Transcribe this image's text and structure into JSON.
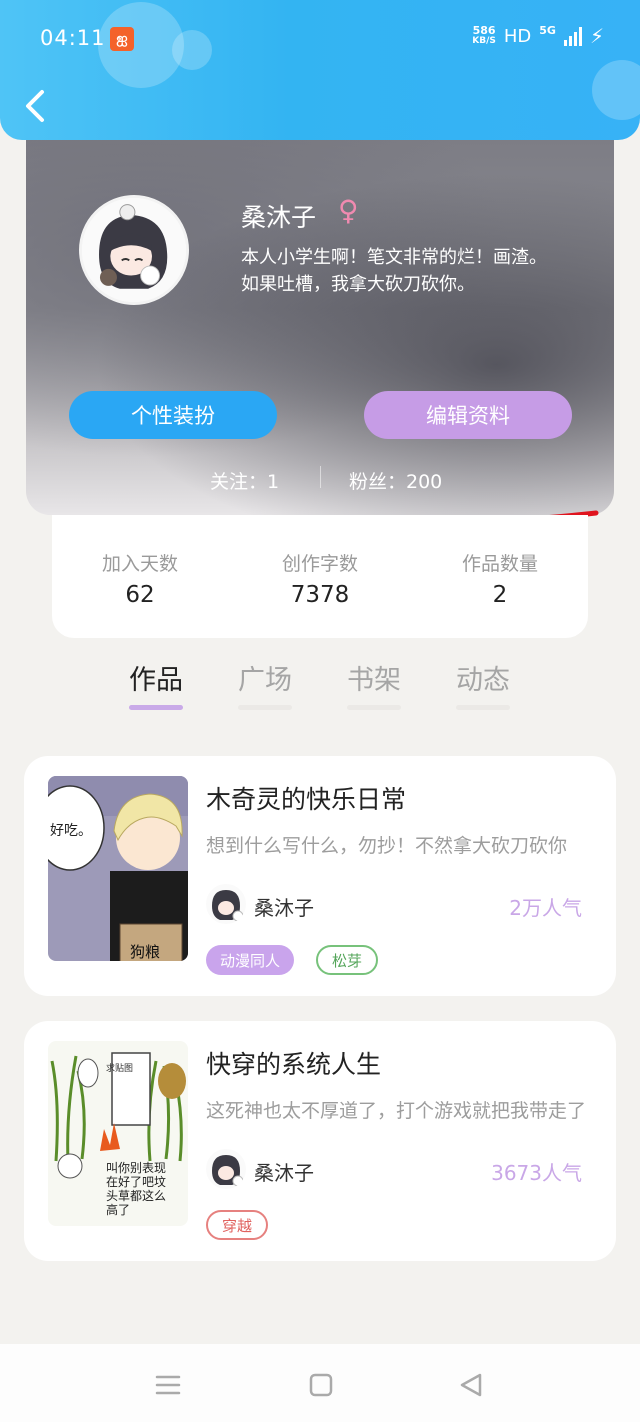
{
  "status_bar": {
    "time": "04:11",
    "app_badge": "ஐ",
    "net_speed_value": "586",
    "net_speed_unit": "KB/S",
    "hd": "HD",
    "network": "5G"
  },
  "profile": {
    "username": "桑沐子",
    "gender_symbol": "♀",
    "bio_line1": "本人小学生啊！笔文非常的烂！画渣。",
    "bio_line2": "如果吐槽，我拿大砍刀砍你。",
    "dress_up_label": "个性装扮",
    "edit_label": "编辑资料",
    "following_text": "关注：1",
    "fans_text": "粉丝：200"
  },
  "stats": [
    {
      "label": "加入天数",
      "value": "62"
    },
    {
      "label": "创作字数",
      "value": "7378"
    },
    {
      "label": "作品数量",
      "value": "2"
    }
  ],
  "tabs": [
    {
      "label": "作品",
      "active": true
    },
    {
      "label": "广场",
      "active": false
    },
    {
      "label": "书架",
      "active": false
    },
    {
      "label": "动态",
      "active": false
    }
  ],
  "works": [
    {
      "title": "木奇灵的快乐日常",
      "description": "想到什么写什么，勿抄！不然拿大砍刀砍你",
      "author": "桑沐子",
      "popularity": "2万人气",
      "cover_text_1": "好吃。",
      "cover_text_2": "狗粮",
      "tags": [
        "动漫同人",
        "松芽"
      ]
    },
    {
      "title": "快穿的系统人生",
      "description": "这死神也太不厚道了，打个游戏就把我带走了",
      "author": "桑沐子",
      "popularity": "3673人气",
      "cover_text_1": "叫你别表现在好了吧坟头草都这么高了",
      "cover_text_2": "求贴图",
      "tags": [
        "穿越"
      ]
    }
  ],
  "colors": {
    "header": "#33b4f2",
    "accent_blue": "#2aa7f4",
    "accent_purple": "#c69ce6",
    "annotation_red": "#e0141e"
  }
}
